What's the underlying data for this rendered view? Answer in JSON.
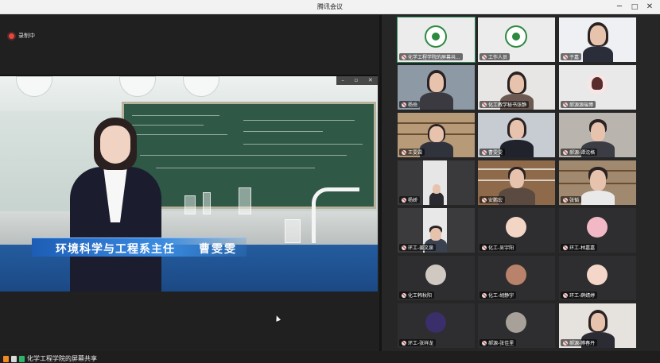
{
  "window": {
    "title": "腾讯会议",
    "min": "─",
    "max": "□",
    "close": "✕"
  },
  "recording": {
    "label": "录制中"
  },
  "video": {
    "caption_role": "环境科学与工程系主任",
    "caption_name": "曹雯雯",
    "controls": [
      "–",
      "▫",
      "✕"
    ]
  },
  "share_label": "化学工程学院的屏幕共享",
  "participants": [
    {
      "name": "化学工程学院的屏幕共...",
      "type": "logo",
      "active": true
    },
    {
      "name": "工作人员",
      "type": "logo"
    },
    {
      "name": "于嘉",
      "type": "camera"
    },
    {
      "name": "杨岳",
      "type": "camera"
    },
    {
      "name": "化工教学秘书张静",
      "type": "camera"
    },
    {
      "name": "郝源源瑞博",
      "type": "avatar"
    },
    {
      "name": "王雯霖",
      "type": "camera"
    },
    {
      "name": "曹雯雯",
      "type": "camera"
    },
    {
      "name": "郝源-谭沈格",
      "type": "camera"
    },
    {
      "name": "杨娇",
      "type": "camera"
    },
    {
      "name": "安鹏宏",
      "type": "camera"
    },
    {
      "name": "张韬",
      "type": "camera"
    },
    {
      "name": "环工-姜文泉",
      "type": "camera"
    },
    {
      "name": "化工-吴宇阳",
      "type": "avatar"
    },
    {
      "name": "环工-林嘉嘉",
      "type": "avatar"
    },
    {
      "name": "化工韩秋阳",
      "type": "avatar"
    },
    {
      "name": "化工-胡静宇",
      "type": "avatar"
    },
    {
      "name": "环工-薛婧婷",
      "type": "avatar"
    },
    {
      "name": "环工-张祥龙",
      "type": "avatar"
    },
    {
      "name": "郝源-张佳里",
      "type": "avatar"
    },
    {
      "name": "郝源-傅春丹",
      "type": "camera"
    }
  ],
  "colors": {
    "accent": "#2e8b57",
    "record": "#e8453c",
    "caption": "#2f7ad1"
  }
}
